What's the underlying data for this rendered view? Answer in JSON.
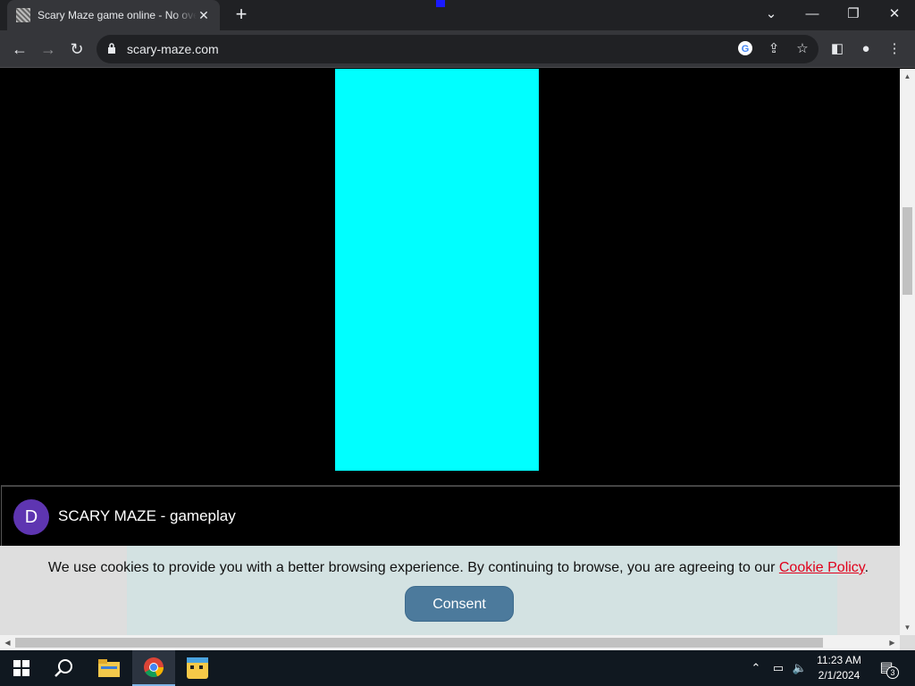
{
  "browser": {
    "tab": {
      "title": "Scary Maze game online - No overlay",
      "close_icon": "close-icon"
    },
    "new_tab_label": "+",
    "window_controls": {
      "tab_search": "chevron-down-icon",
      "minimize": "minimize-icon",
      "restore": "restore-icon",
      "close": "close-icon"
    },
    "url": "scary-maze.com",
    "colors": {
      "frame": "#202124",
      "toolbar": "#35363a"
    }
  },
  "page": {
    "maze_color": "#00ffff",
    "video": {
      "avatar_letter": "D",
      "title": "SCARY MAZE - gameplay"
    },
    "cookie_banner": {
      "text": "We use cookies to provide you with a better browsing experience. By continuing to browse, you are agreeing to our ",
      "link": "Cookie Policy",
      "suffix": ".",
      "consent_label": "Consent"
    }
  },
  "taskbar": {
    "clock_time": "11:23 AM",
    "clock_date": "2/1/2024",
    "notification_count": "3",
    "pinned": [
      "windows-start-icon",
      "search-icon",
      "file-explorer-icon",
      "chrome-icon",
      "game-app-icon"
    ]
  }
}
